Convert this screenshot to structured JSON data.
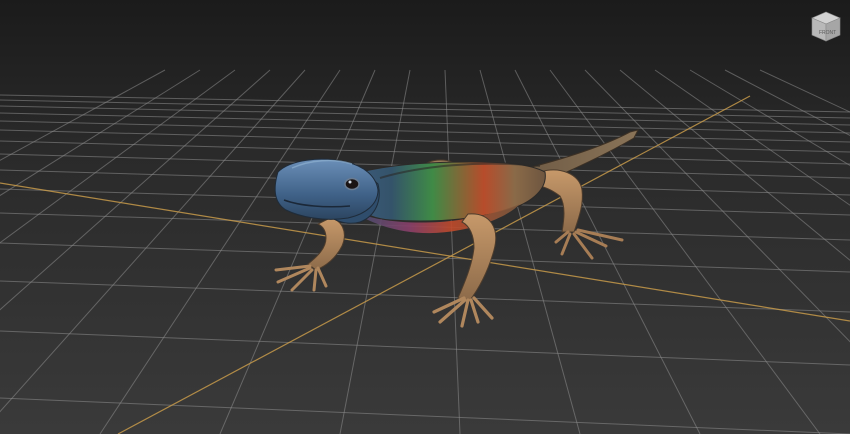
{
  "viewport": {
    "background_top": "#1b1b1b",
    "background_bottom": "#3a3a3a",
    "grid_color": "#8e8e8e",
    "axis_color": "#c79a4a"
  },
  "viewcube": {
    "face_label": "FRONT",
    "icon": "viewcube-icon"
  },
  "model": {
    "icon": "lizard-model",
    "colors": {
      "head": "#4e6f95",
      "body_green": "#3f8a46",
      "body_red": "#c04a2a",
      "skin": "#b88a5e",
      "dark_skin": "#6e5640"
    }
  }
}
